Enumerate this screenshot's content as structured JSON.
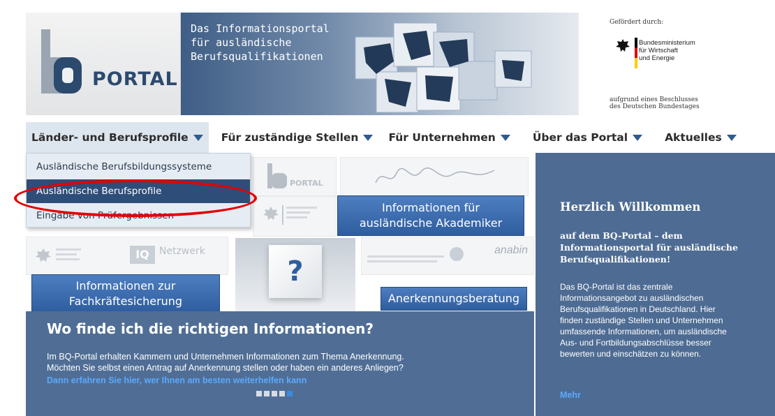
{
  "header": {
    "logo_text": "PORTAL",
    "banner_lines": [
      "Das Informationsportal",
      "für ausländische",
      "Berufsqualifikationen"
    ],
    "sponsor_label": "Gefördert durch:",
    "ministry_lines": [
      "Bundesministerium",
      "für Wirtschaft",
      "und Energie"
    ],
    "decision_lines": [
      "aufgrund eines Beschlusses",
      "des Deutschen Bundestages"
    ]
  },
  "nav": {
    "items": [
      {
        "label": "Länder- und Berufsprofile"
      },
      {
        "label": "Für zuständige Stellen"
      },
      {
        "label": "Für Unternehmen"
      },
      {
        "label": "Über das Portal"
      },
      {
        "label": "Aktuelles"
      }
    ]
  },
  "dropdown": {
    "items": [
      {
        "label": "Ausländische Berufsbildungssysteme"
      },
      {
        "label": "Ausländische Berufsprofile"
      },
      {
        "label": "Eingabe von Prüfergebnissen"
      }
    ]
  },
  "collage": {
    "btn_akademiker": [
      "Informationen für",
      "ausländische Akademiker"
    ],
    "btn_fachkraefte": [
      "Informationen zur",
      "Fachkräftesicherung"
    ],
    "btn_beratung": "Anerkennungsberatung",
    "netzwerk_label": "Netzwerk",
    "anabin_label": "anabin",
    "question_mark": "?"
  },
  "lower": {
    "title": "Wo finde ich die richtigen Informationen?",
    "text_lines": [
      "Im BQ-Portal erhalten Kammern und Unternehmen Informationen zum Thema Anerkennung.",
      "Möchten Sie selbst einen Antrag auf Anerkennung stellen oder haben ein anderes Anliegen?"
    ],
    "link": "Dann erfahren Sie hier, wer Ihnen am besten weiterhelfen kann"
  },
  "welcome": {
    "title": "Herzlich Willkommen",
    "subtitle_lines": [
      "auf dem BQ-Portal – dem",
      "Informationsportal für ausländische",
      "Berufsqualifikationen!"
    ],
    "body_lines": [
      "Das BQ-Portal ist das zentrale",
      "Informationsangebot zu ausländischen",
      "Berufsqualifikationen in Deutschland. Hier",
      "finden zuständige Stellen und Unternehmen",
      "umfassende Informationen, um ausländische",
      "Aus- und Fortbildungsabschlüsse besser",
      "bewerten und einschätzen zu können."
    ],
    "more_link": "Mehr"
  },
  "colors": {
    "nav_arrow": "#2f5b8e",
    "panel_blue": "#4e6c93",
    "button_blue": "#2f5e9f",
    "link_blue": "#5aa9ff",
    "highlight_red": "#e30000"
  }
}
